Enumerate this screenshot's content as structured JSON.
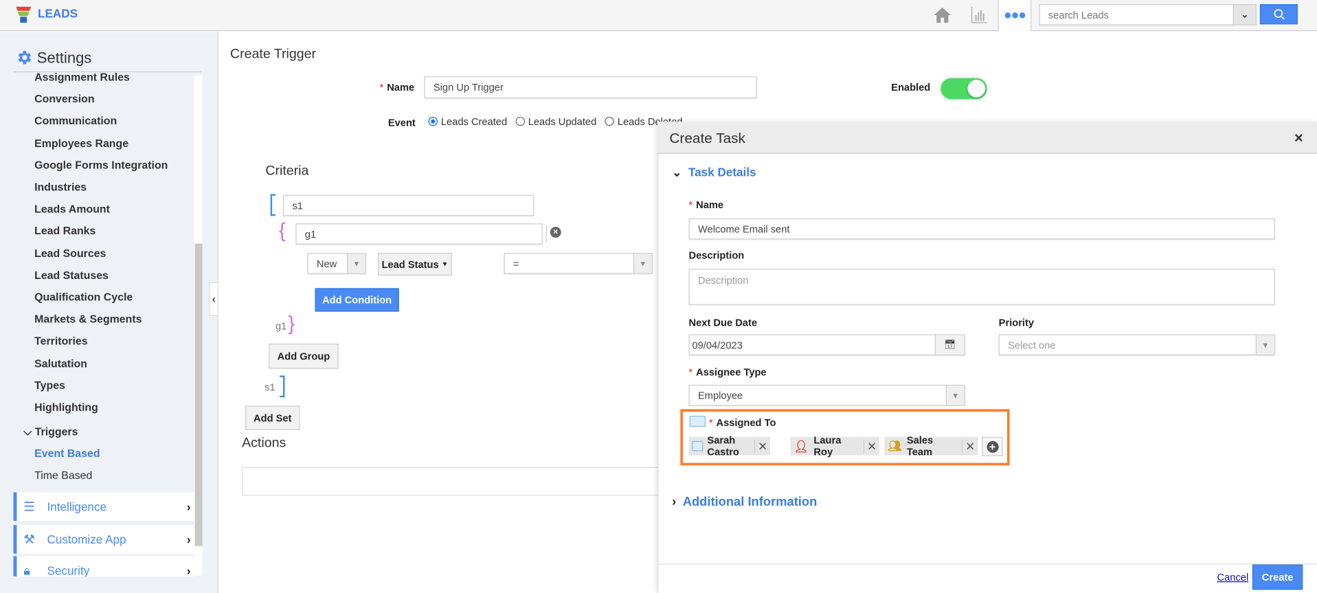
{
  "app": {
    "title": "LEADS"
  },
  "topbar": {
    "search_placeholder": "search Leads",
    "icons": [
      "home-icon",
      "chart-icon",
      "more-icon",
      "search-icon"
    ]
  },
  "sidebar": {
    "title": "Settings",
    "items": [
      "Assignment Rules",
      "Conversion",
      "Communication",
      "Employees Range",
      "Google Forms Integration",
      "Industries",
      "Leads Amount",
      "Lead Ranks",
      "Lead Sources",
      "Lead Statuses",
      "Qualification Cycle",
      "Markets & Segments",
      "Territories",
      "Salutation",
      "Types",
      "Highlighting"
    ],
    "triggers": {
      "label": "Triggers",
      "children": [
        {
          "label": "Event Based",
          "active": true
        },
        {
          "label": "Time Based",
          "active": false
        }
      ]
    },
    "sections": [
      {
        "label": "Intelligence",
        "icon": "list-icon"
      },
      {
        "label": "Customize App",
        "icon": "tools-icon"
      },
      {
        "label": "Security",
        "icon": "lock-icon"
      }
    ]
  },
  "main": {
    "title": "Create Trigger",
    "name_label": "Name",
    "name_value": "Sign Up Trigger",
    "enabled_label": "Enabled",
    "enabled": true,
    "event_label": "Event",
    "events": [
      {
        "label": "Leads Created",
        "selected": true
      },
      {
        "label": "Leads Updated",
        "selected": false
      },
      {
        "label": "Leads Deleted",
        "selected": false
      }
    ],
    "criteria": {
      "title": "Criteria",
      "set_name": "s1",
      "group_name": "g1",
      "condition": {
        "value": "New",
        "field": "Lead Status",
        "operator": "="
      },
      "add_condition": "Add Condition",
      "add_group": "Add Group",
      "add_set": "Add Set"
    },
    "actions_title": "Actions"
  },
  "modal": {
    "title": "Create Task",
    "task_details": "Task Details",
    "name_label": "Name",
    "name_value": "Welcome Email sent",
    "description_label": "Description",
    "description_placeholder": "Description",
    "due_label": "Next Due Date",
    "due_value": "09/04/2023",
    "priority_label": "Priority",
    "priority_placeholder": "Select one",
    "assignee_type_label": "Assignee Type",
    "assignee_type_value": "Employee",
    "assigned_to_label": "Assigned To",
    "assignees": [
      {
        "name": "Sarah Castro",
        "icon": "contact-card-icon"
      },
      {
        "name": "Laura Roy",
        "icon": "user-icon"
      },
      {
        "name": "Sales Team",
        "icon": "team-icon"
      }
    ],
    "additional_info": "Additional Information",
    "cancel": "Cancel",
    "create": "Create",
    "highlight_color": "#fd7f28",
    "accent": "#4a8af4"
  }
}
